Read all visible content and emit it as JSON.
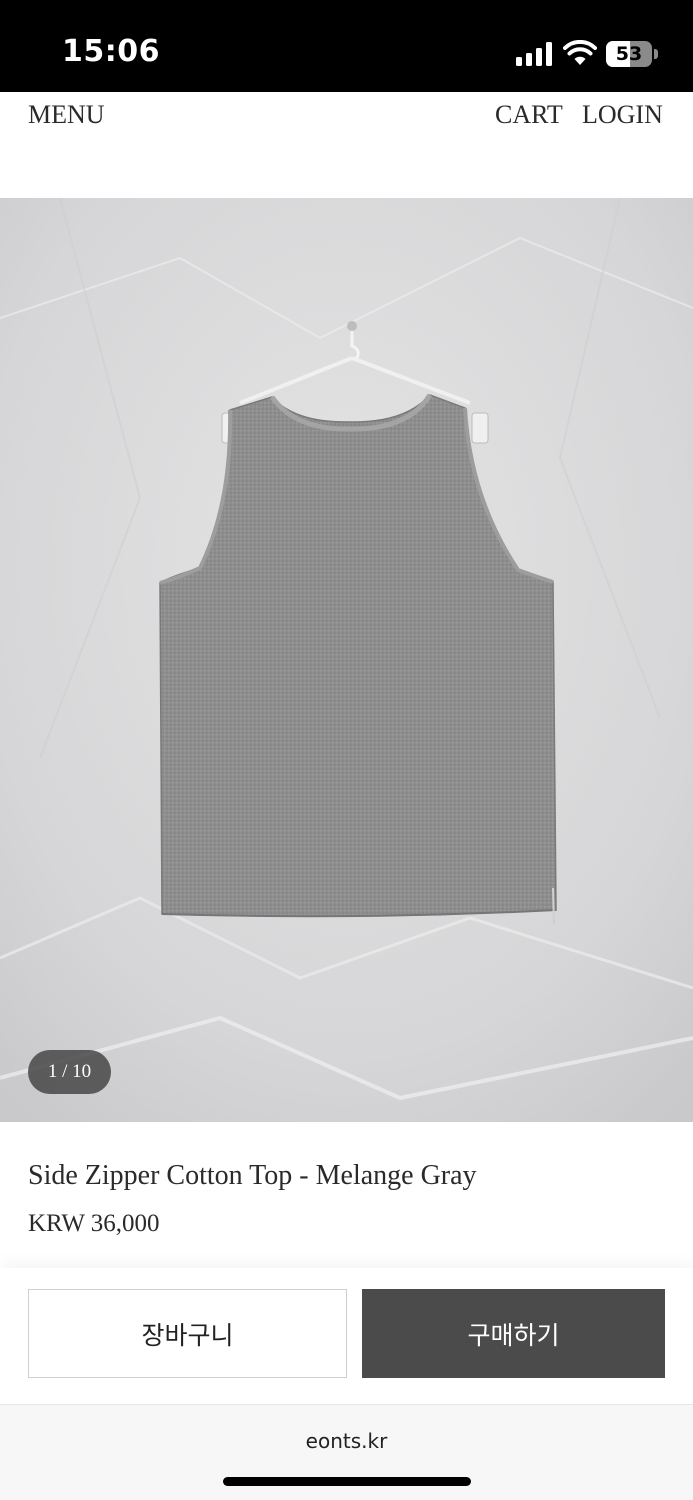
{
  "status_bar": {
    "time": "15:06",
    "battery_level": "53",
    "battery_fraction": 0.53,
    "icons": [
      "signal-icon",
      "wifi-icon",
      "battery-icon"
    ]
  },
  "header": {
    "menu_label": "MENU",
    "cart_label": "CART",
    "login_label": "LOGIN"
  },
  "product": {
    "image_counter": "1 / 10",
    "title": "Side Zipper Cotton Top - Melange Gray",
    "price": "KRW 36,000"
  },
  "actions": {
    "cart_button": "장바구니",
    "buy_button": "구매하기"
  },
  "browser": {
    "url": "eonts.kr"
  },
  "colors": {
    "buy_button_bg": "#4b4b4b",
    "counter_bg": "#464646",
    "garment": "#8f8f8f",
    "backdrop": "#dadada"
  }
}
